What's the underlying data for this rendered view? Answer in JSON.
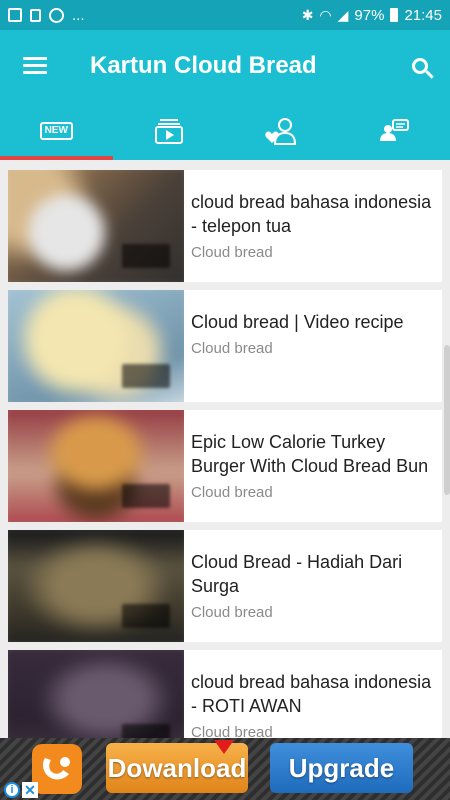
{
  "status_bar": {
    "left_icons": [
      "image-icon",
      "lock-icon",
      "whatsapp-icon"
    ],
    "overflow": "...",
    "battery": "97%",
    "time": "21:45"
  },
  "app_bar": {
    "title": "Kartun Cloud Bread"
  },
  "tabs": {
    "new_label": "NEW",
    "active_index": 0,
    "icons": [
      "new-icon",
      "subscriptions-icon",
      "favorite-user-icon",
      "chat-user-icon"
    ]
  },
  "videos": [
    {
      "title": "cloud bread bahasa indonesia - telepon tua",
      "channel": "Cloud bread"
    },
    {
      "title": "Cloud bread | Video recipe",
      "channel": "Cloud bread"
    },
    {
      "title": "Epic Low Calorie Turkey Burger With Cloud Bread Bun",
      "channel": "Cloud bread"
    },
    {
      "title": "Cloud Bread - Hadiah Dari Surga",
      "channel": "Cloud bread"
    },
    {
      "title": "cloud bread bahasa indonesia - ROTI AWAN",
      "channel": "Cloud bread"
    }
  ],
  "ad": {
    "download_label": "Dowanload",
    "upgrade_label": "Upgrade",
    "info_label": "i",
    "close_label": "✕"
  },
  "colors": {
    "primary": "#1cbfd1",
    "status_bar": "#15a3b7",
    "tab_indicator": "#e04646"
  }
}
